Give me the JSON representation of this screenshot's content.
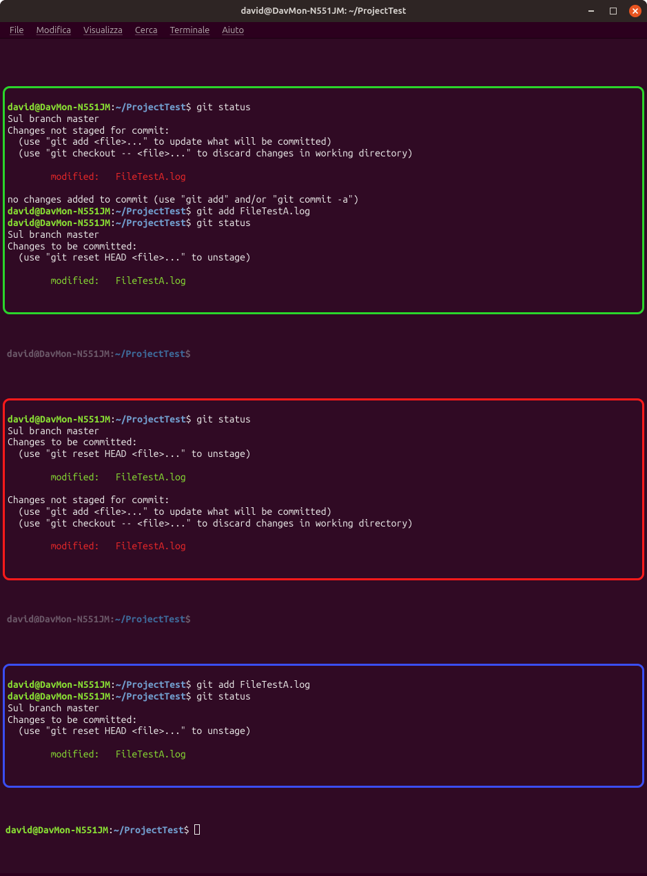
{
  "window": {
    "title": "david@DavMon-N551JM: ~/ProjectTest"
  },
  "menubar": [
    "File",
    "Modifica",
    "Visualizza",
    "Cerca",
    "Terminale",
    "Aiuto"
  ],
  "prompt": {
    "user_host": "david@DavMon-N551JM",
    "colon": ":",
    "path": "~/ProjectTest",
    "sigil": "$"
  },
  "cmd": {
    "git_status": "git status",
    "git_add": "git add FileTestA.log"
  },
  "msg": {
    "branch": "Sul branch master",
    "not_staged_header": "Changes not staged for commit:",
    "hint_add": "  (use \"git add <file>...\" to update what will be committed)",
    "hint_checkout": "  (use \"git checkout -- <file>...\" to discard changes in working directory)",
    "no_changes_added": "no changes added to commit (use \"git add\" and/or \"git commit -a\")",
    "to_commit_header": "Changes to be committed:",
    "hint_reset": "  (use \"git reset HEAD <file>...\" to unstage)",
    "modified": "        modified:   FileTestA.log",
    "blank": ""
  },
  "ghost": {
    "prefix": "david@DavMon-N551JM",
    "path": "~/ProjectTest",
    "sigil": "$"
  }
}
